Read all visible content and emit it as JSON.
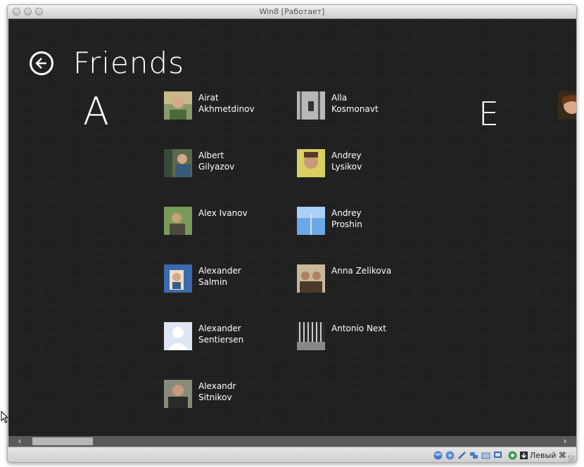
{
  "window": {
    "title": "Win8 [Работает]"
  },
  "page": {
    "title": "Friends"
  },
  "groups": [
    {
      "letter": "A",
      "friends": [
        {
          "name": "Airat\nAkhmetdinov"
        },
        {
          "name": "Albert\nGilyazov"
        },
        {
          "name": "Alex Ivanov"
        },
        {
          "name": "Alexander\nSalmin"
        },
        {
          "name": "Alexander\nSentiersen"
        },
        {
          "name": "Alexandr\nSitnikov"
        },
        {
          "name": "Alla\nKosmonavt"
        },
        {
          "name": "Andrey\nLysikov"
        },
        {
          "name": "Andrey\nProshin"
        },
        {
          "name": "Anna  Zelikova"
        },
        {
          "name": "Antonio Next"
        }
      ]
    },
    {
      "letter": "E",
      "friends": []
    }
  ],
  "statusbar": {
    "host_key": "Левый ⌘"
  },
  "icons": {
    "back": "back-arrow-icon",
    "scroll_left": "‹",
    "scroll_right": "›"
  },
  "colors": {
    "background": "#1f1f1f",
    "text": "#ffffff",
    "scrollbar": "#5a5a5a"
  }
}
